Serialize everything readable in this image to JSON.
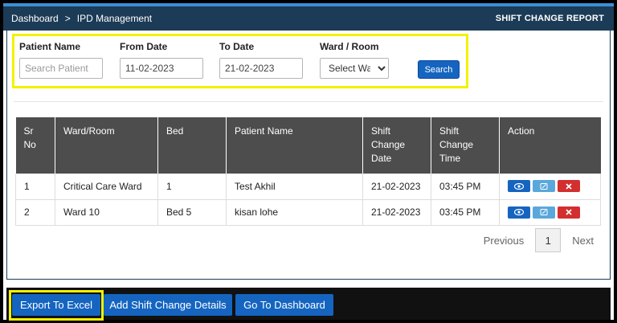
{
  "breadcrumb": {
    "home": "Dashboard",
    "separator": ">",
    "current": "IPD Management"
  },
  "report_title": "SHIFT CHANGE REPORT",
  "filters": {
    "patient_name": {
      "label": "Patient Name",
      "placeholder": "Search Patient",
      "value": ""
    },
    "from_date": {
      "label": "From Date",
      "value": "11-02-2023"
    },
    "to_date": {
      "label": "To Date",
      "value": "21-02-2023"
    },
    "ward_room": {
      "label": "Ward / Room",
      "selected": "Select Ward"
    },
    "search_label": "Search"
  },
  "table": {
    "headers": [
      "Sr No",
      "Ward/Room",
      "Bed",
      "Patient Name",
      "Shift Change Date",
      "Shift Change Time",
      "Action"
    ],
    "rows": [
      {
        "sr": "1",
        "ward": "Critical Care Ward",
        "bed": "1",
        "patient": "Test Akhil",
        "date": "21-02-2023",
        "time": "03:45 PM"
      },
      {
        "sr": "2",
        "ward": "Ward 10",
        "bed": "Bed 5",
        "patient": "kisan lohe",
        "date": "21-02-2023",
        "time": "03:45 PM"
      }
    ]
  },
  "pagination": {
    "previous": "Previous",
    "current_page": "1",
    "next": "Next"
  },
  "footer": {
    "export_label": "Export To Excel",
    "add_label": "Add Shift Change Details",
    "dashboard_label": "Go To Dashboard"
  },
  "icons": {
    "view": "eye-icon",
    "edit": "edit-icon",
    "delete": "close-icon"
  },
  "colors": {
    "header": "#1c3b57",
    "primary": "#1565c0",
    "highlight": "#f2f200",
    "danger": "#d32f2f"
  }
}
